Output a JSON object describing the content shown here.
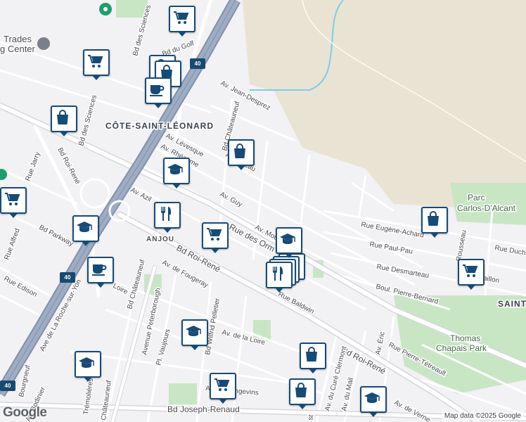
{
  "map": {
    "labels": {
      "district_main": "CÔTE-SAINT-LÉONARD",
      "district_anjou": "ANJOU",
      "district_saint": "SAINT",
      "trades_line1": "Trades",
      "trades_line2": "g Center",
      "park_thomas_1": "Thomas",
      "park_thomas_2": "Chapais Park",
      "park_carlos_1": "Parc",
      "park_carlos_2": "Carlos-D'Alcant"
    },
    "streets": {
      "bd_des_sciences_top": "Bd des Sciences",
      "bd_du_golf": "Bd du Golf",
      "bd_des_sciences_left": "Bd des Sciences",
      "jean_desprez": "Av. Jean-Desprez",
      "bd_chateauneuf_top": "Bd Châteauneuf",
      "av_levesque": "Av. Lévesque",
      "av_rheaume": "Av. Rhéaume",
      "av_deau": "Av. ...deau",
      "av_guy": "Av. Guy",
      "rue_jarry": "Rue Jarry",
      "bd_roi_rene_left": "Bd Roi-René",
      "av_azilda": "Av. Azil",
      "rue_des_ormeaux": "Rue des Orm",
      "av_mou": "Av. Mou",
      "rue_eugene_achard": "Rue Eugène-Achard",
      "rue_paul_pau": "Rue Paul-Pau",
      "rue_duchesneau": "Rue Duch",
      "rue_desmarteau": "Rue Desmarteau",
      "boul_pierre_bernard": "Boul. Pierre-Bernard",
      "rue_baillon": "Baillon",
      "rue_rousseau": "Rousseau",
      "bd_parkway": "Bd Parkway",
      "rue_alfred": "Rue Alfred",
      "rue_edison": "Rue Edison",
      "av_roche_sur_yon": "Ave de La Roche-sur-Yon",
      "av_loire_top": "Loire",
      "av_fougeray": "Av. de Fougeray",
      "bd_chateauneuf_low": "Bd Châteauneuf",
      "bd_roi_rene_mid": "Bd Roi-René",
      "rue_baldwin": "Rue Baldwin",
      "av_peterborough": "Avenue Peterborough",
      "bd_wilfrid_pelletier": "Bd Wilfrid Pelletier",
      "pl_vaujours": "Pl. Vaujours",
      "av_de_la_loire": "Av. de la Loire",
      "bd_roi_rene_right": "Bd Roi-René",
      "av_eric": "Av. Éric",
      "rue_pierre_tetreault": "Rue Pierre-Tétreault",
      "av_langevins": "Av. des Angevins",
      "av_du_cure_clermont": "Av. du Curé Clermont",
      "av_du_mail": "Av. du Mail",
      "bd_joseph_renaud": "Bd Joseph-Renaud",
      "av_de_verne": "Av. de Verne",
      "av_bodinier": "Av. Bodinier",
      "bourgneuf": "Bourgneuf",
      "tremolieres": "Trémolières",
      "chateauneuf_bottom": "Châteauneuf",
      "st": "st"
    },
    "highway_shields": [
      "40",
      "40",
      "40"
    ]
  },
  "attribution": "Map data ©2025 Google",
  "logo": "Google",
  "colors": {
    "marker_border": "#154b78",
    "marker_fill": "#ffffff",
    "highway": "#8c9cb3",
    "park": "#c8e6c4",
    "farmland": "#e8e2d4"
  },
  "markers": [
    {
      "icon": "cart-icon"
    },
    {
      "icon": "cart-icon"
    },
    {
      "icon": "shopping-bag-icon"
    },
    {
      "icon": "shopping-bag-icon"
    },
    {
      "icon": "coffee-cup-icon"
    },
    {
      "icon": "shopping-bag-icon"
    },
    {
      "icon": "shopping-bag-icon"
    },
    {
      "icon": "graduation-cap-icon"
    },
    {
      "icon": "cutlery-icon"
    },
    {
      "icon": "cart-icon"
    },
    {
      "icon": "graduation-cap-icon"
    },
    {
      "icon": "graduation-cap-icon"
    },
    {
      "icon": "cutlery-icon"
    },
    {
      "icon": "shopping-bag-icon"
    },
    {
      "icon": "cart-icon"
    },
    {
      "icon": "coffee-cup-icon"
    },
    {
      "icon": "graduation-cap-icon"
    },
    {
      "icon": "graduation-cap-icon"
    },
    {
      "icon": "shopping-bag-icon"
    },
    {
      "icon": "cart-icon"
    },
    {
      "icon": "shopping-bag-icon"
    },
    {
      "icon": "graduation-cap-icon"
    },
    {
      "icon": "cart-icon"
    }
  ]
}
